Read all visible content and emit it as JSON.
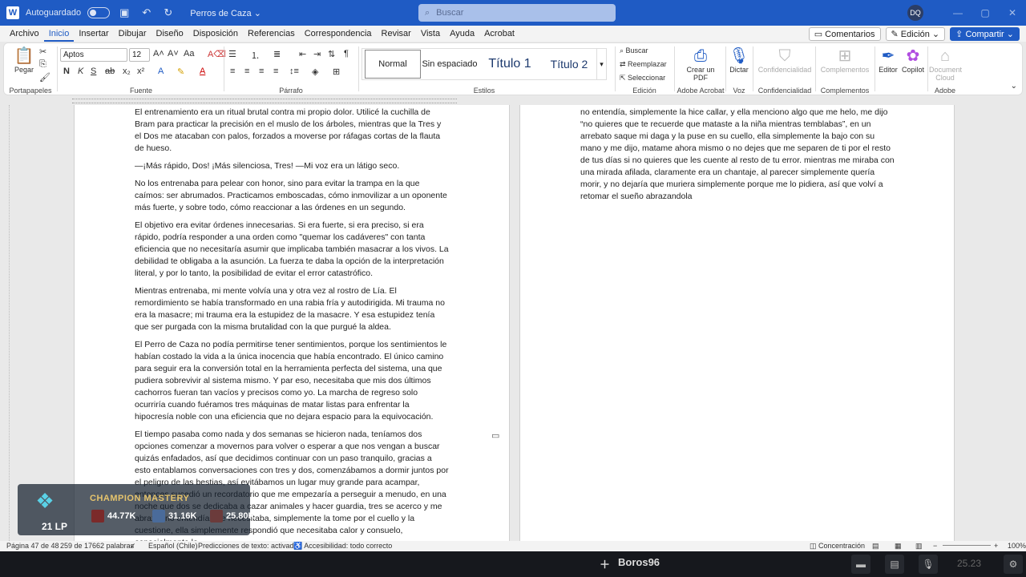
{
  "titlebar": {
    "app_logo": "W",
    "autosave_label": "Autoguardado",
    "doc_title": "Perros de Caza ⌄",
    "search_placeholder": "Buscar",
    "avatar_initials": "DQ"
  },
  "menu": {
    "tabs": [
      "Archivo",
      "Inicio",
      "Insertar",
      "Dibujar",
      "Diseño",
      "Disposición",
      "Referencias",
      "Correspondencia",
      "Revisar",
      "Vista",
      "Ayuda",
      "Acrobat"
    ],
    "active_tab": "Inicio",
    "comments_label": "Comentarios",
    "edit_mode_label": "Edición ⌄",
    "share_label": "Compartir ⌄"
  },
  "ribbon": {
    "clipboard": {
      "paste_label": "Pegar",
      "group_label": "Portapapeles"
    },
    "font": {
      "font_name": "Aptos",
      "font_size": "12",
      "group_label": "Fuente"
    },
    "paragraph": {
      "group_label": "Párrafo"
    },
    "styles": {
      "items": [
        "Normal",
        "Sin espaciado",
        "Título 1",
        "Título 2"
      ],
      "group_label": "Estilos"
    },
    "editing": {
      "find_label": "Buscar",
      "replace_label": "Reemplazar",
      "select_label": "Seleccionar",
      "group_label": "Edición"
    },
    "acrobat": {
      "create_pdf_label": "Crear un PDF",
      "group_label": "Adobe Acrobat"
    },
    "voice": {
      "dictate_label": "Dictar",
      "group_label": "Voz"
    },
    "sensitivity": {
      "label": "Confidencialidad",
      "group_label": "Confidencialidad"
    },
    "addins": {
      "label": "Complementos",
      "group_label": "Complementos"
    },
    "editor_label": "Editor",
    "copilot_label": "Copilot",
    "doc_cloud_label": "Document Cloud",
    "adobe_group_label": "Adobe"
  },
  "page1": {
    "paragraphs": [
      "El entrenamiento era un ritual brutal contra mi propio dolor. Utilicé la cuchilla de Bram para practicar la precisión en el muslo de los árboles, mientras que la Tres y el Dos me atacaban con palos, forzados a moverse por ráfagas cortas de la flauta de hueso.",
      "—¡Más rápido, Dos! ¡Más silenciosa, Tres! —Mi voz era un látigo seco.",
      "No los entrenaba para pelear con honor, sino para evitar la trampa en la que caímos: ser abrumados. Practicamos emboscadas, cómo inmovilizar a un oponente más fuerte, y sobre todo, cómo reaccionar a las órdenes en un segundo.",
      "El objetivo era evitar órdenes innecesarias. Si era fuerte, si era preciso, si era rápido, podría responder a una orden como \"quemar los cadáveres\" con tanta eficiencia que no necesitaría asumir que implicaba también masacrar a los vivos. La debilidad te obligaba a la asunción. La fuerza te daba la opción de la interpretación literal, y por lo tanto, la posibilidad de evitar el error catastrófico.",
      "Mientras entrenaba, mi mente volvía una y otra vez al rostro de Lía. El remordimiento se había transformado en una rabia fría y autodirigida. Mi trauma no era la masacre; mi trauma era la estupidez de la masacre. Y esa estupidez tenía que ser purgada con la misma brutalidad con la que purgué la aldea.",
      "El Perro de Caza no podía permitirse tener sentimientos, porque los sentimientos le habían costado la vida a la única inocencia que había encontrado. El único camino para seguir era la conversión total en la herramienta perfecta del sistema, una que pudiera sobrevivir al sistema mismo. Y par eso, necesitaba que mis dos últimos cachorros fueran tan vacíos y precisos como yo. La marcha de regreso solo ocurriría cuando fuéramos tres máquinas de matar listas para enfrentar la hipocresía noble con una eficiencia que no dejara espacio para la equivocación.",
      "El tiempo pasaba como nada y dos semanas se hicieron nada, teníamos dos opciones comenzar a movernos para volver o esperar a que nos vengan a buscar quizás enfadados, así que decidimos continuar con un paso tranquilo, gracias a esto entablamos conversaciones con tres y dos, comenzábamos a dormir juntos por el peligro de las bestias, así evitábamos un lugar muy grande para acampar, entonces sucedió un recordatorio que me empezaría a perseguir a menudo, en una noche que dos se dedicaba a cazar animales y hacer guardia, tres se acerco y me abrazo, no entendía que necesitaba, simplemente la tome por el cuello y la cuestione, ella simplemente respondió que necesitaba calor y consuelo, especialmente lo"
    ]
  },
  "page2": {
    "paragraphs": [
      "no entendía, simplemente la hice callar, y ella menciono algo que me helo, me dijo “no quieres que te recuerde que mataste a la niña mientras temblabas”, en un arrebato saque mi daga y la puse en su cuello, ella simplemente la bajo con su mano y me dijo, matame ahora mismo o no dejes que me separen de ti por el resto de tus días si no quieres que les cuente al resto de tu error. mientras me miraba con una mirada afilada, claramente era un chantaje, al parecer simplemente quería morir, y no dejaría que muriera simplemente porque me lo pidiera, así que volví a retomar el sueño abrazandola"
    ]
  },
  "overlay": {
    "title": "CHAMPION MASTERY",
    "lp": "21 LP",
    "stats": [
      "44.77K",
      "31.16K",
      "25.80K"
    ]
  },
  "statusbar": {
    "page": "Página 47 de 48",
    "words": "259 de 17662 palabras",
    "language": "Español (Chile)",
    "predictions": "Predicciones de texto: activado",
    "accessibility": "Accesibilidad: todo correcto",
    "focus": "Concentración",
    "zoom": "100%"
  },
  "taskbar": {
    "player_name": "Boros96",
    "time": "25.23"
  },
  "colors": {
    "accent": "#1f5bc4",
    "titlebar": "#1f5bc4"
  }
}
